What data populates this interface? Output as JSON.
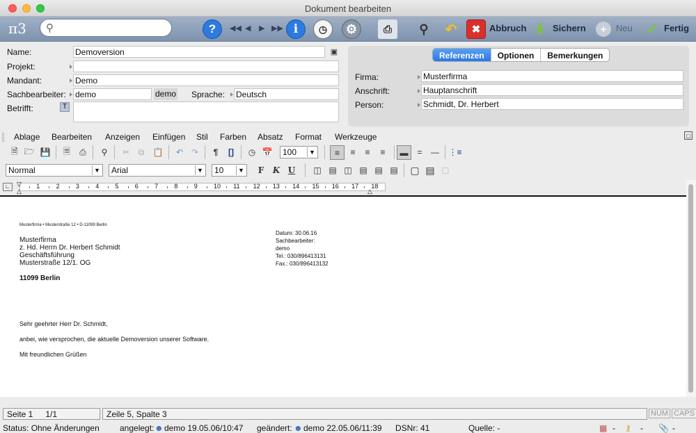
{
  "window": {
    "title": "Dokument bearbeiten"
  },
  "toolbar": {
    "logo": "π3",
    "search_placeholder": "",
    "abbruch": "Abbruch",
    "sichern": "Sichern",
    "neu": "Neu",
    "fertig": "Fertig",
    "zoom": "100"
  },
  "form": {
    "name_label": "Name:",
    "name_value": "Demoversion",
    "projekt_label": "Projekt:",
    "projekt_value": "",
    "mandant_label": "Mandant:",
    "mandant_value": "Demo",
    "sachbearbeiter_label": "Sachbearbeiter:",
    "sachbearbeiter_value": "demo",
    "sachbearbeiter_tag": "demo",
    "sprache_label": "Sprache:",
    "sprache_value": "Deutsch",
    "betrifft_label": "Betrifft:",
    "betrifft_btn": "T",
    "betrifft_value": ""
  },
  "refpanel": {
    "tabs": [
      "Referenzen",
      "Optionen",
      "Bemerkungen"
    ],
    "firma_label": "Firma:",
    "firma_value": "Musterfirma",
    "anschrift_label": "Anschrift:",
    "anschrift_value": "Hauptanschrift",
    "person_label": "Person:",
    "person_value": "Schmidt, Dr. Herbert"
  },
  "menubar": [
    "Ablage",
    "Bearbeiten",
    "Anzeigen",
    "Einfügen",
    "Stil",
    "Farben",
    "Absatz",
    "Format",
    "Werkzeuge"
  ],
  "format": {
    "style": "Normal",
    "font": "Arial",
    "size": "10",
    "bold": "F",
    "italic": "K",
    "underline": "U"
  },
  "ruler": [
    "1",
    "2",
    "3",
    "4",
    "5",
    "6",
    "7",
    "8",
    "9",
    "10",
    "11",
    "12",
    "13",
    "14",
    "15",
    "16",
    "17",
    "18"
  ],
  "document": {
    "sender_line": "Musterfirma • Musterstraße 12 • D-11099 Berlin",
    "address": [
      "Musterfirma",
      "z. Hd. Herrn Dr. Herbert Schmidt",
      "Geschäftsführung",
      "Musterstraße 12/1. OG"
    ],
    "city": "11099 Berlin",
    "info": [
      "Datum: 30.06.16",
      "Sachbearbeiter:",
      "demo",
      "Tel.: 030/896413131",
      "Fax.: 030/896413132"
    ],
    "salutation": "Sehr geehrter Herr Dr. Schmidt,",
    "body": "anbei, wie versprochen, die aktuelle Demoversion unserer Software.",
    "closing": "Mit freundlichen Grüßen"
  },
  "status": {
    "seite": "Seite 1",
    "pages": "1/1",
    "position": "Zeile 5, Spalte 3",
    "num": "NUM",
    "caps": "CAPS",
    "status_text": "Status:  Ohne Änderungen",
    "angelegt_label": "angelegt:",
    "angelegt_value": "demo 19.05.06/10:47",
    "geaendert_label": "geändert:",
    "geaendert_value": "demo 22.05.06/11:39",
    "dsnr": "DSNr: 41",
    "quelle": "Quelle: -",
    "dash1": "-",
    "dash2": "-",
    "dash3": "-"
  }
}
